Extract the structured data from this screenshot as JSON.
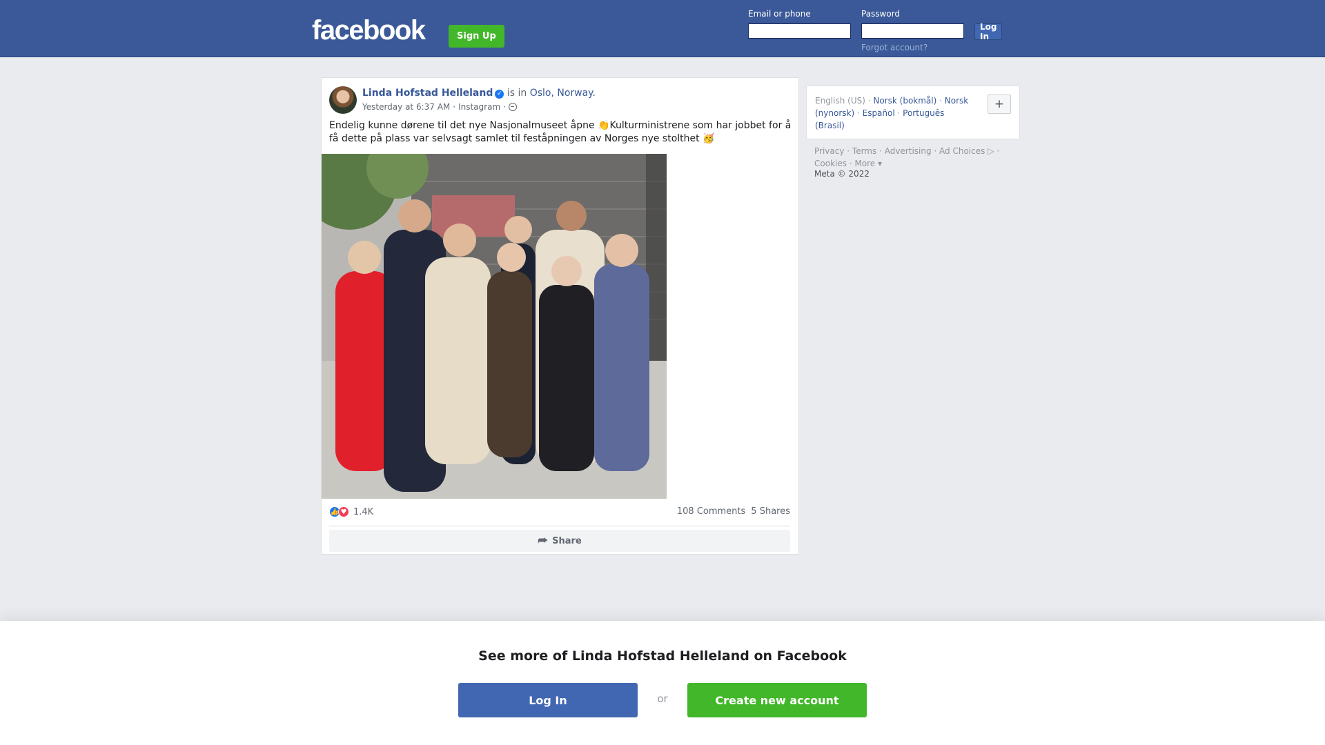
{
  "topbar": {
    "logo": "facebook",
    "signup_label": "Sign Up",
    "email_label": "Email or phone",
    "password_label": "Password",
    "login_label": "Log In",
    "forgot_label": "Forgot account?"
  },
  "post": {
    "author": "Linda Hofstad Helleland",
    "verified_icon": "verified-badge-icon",
    "is_in": "is in",
    "location": "Oslo, Norway.",
    "time": "Yesterday at 6:37 AM",
    "separator": "·",
    "source": "Instagram",
    "privacy_icon": "globe-icon",
    "text": "Endelig kunne dørene til det nye Nasjonalmuseet åpne 👏Kulturministrene som har jobbet for å få dette på plass var selvsagt samlet til feståpningen av Norges nye stolthet 🥳",
    "reaction_count": "1.4K",
    "comments": "108 Comments",
    "shares": "5 Shares",
    "share_label": "Share"
  },
  "sidebar": {
    "current_language": "English (US)",
    "languages": [
      "Norsk (bokmål)",
      "Norsk (nynorsk)",
      "Español",
      "Português (Brasil)"
    ],
    "plus_label": "+",
    "footer": [
      "Privacy",
      "Terms",
      "Advertising",
      "Ad Choices",
      "Cookies",
      "More"
    ],
    "copyright": "Meta © 2022"
  },
  "bottom": {
    "title": "See more of Linda Hofstad Helleland on Facebook",
    "login_label": "Log In",
    "or_label": "or",
    "create_label": "Create new account"
  },
  "colors": {
    "brand_blue": "#3b5998",
    "button_blue": "#4267b2",
    "green": "#42b72a",
    "link": "#385898"
  }
}
